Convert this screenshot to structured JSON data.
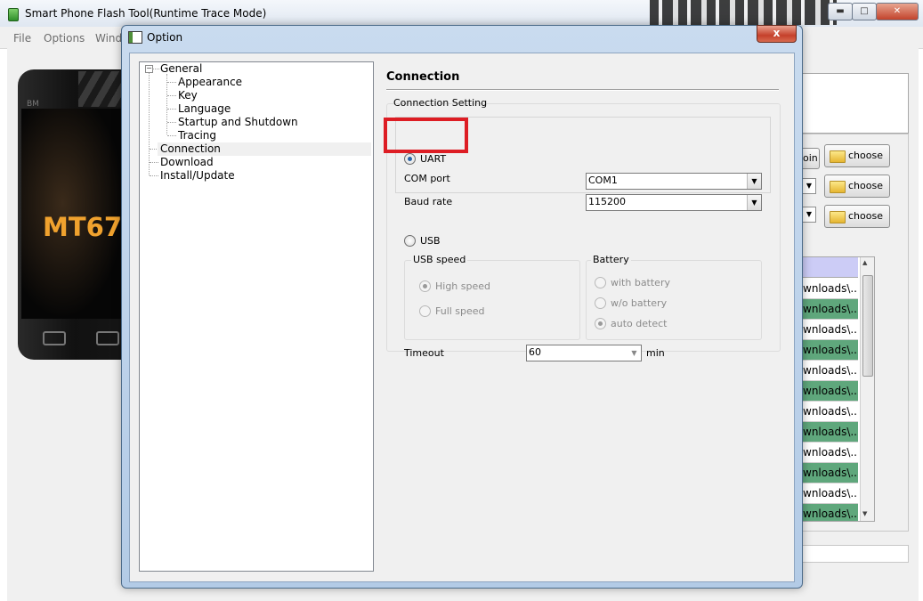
{
  "main_window": {
    "title": "Smart Phone Flash Tool(Runtime Trace Mode)",
    "menu": [
      "File",
      "Options",
      "Wind"
    ],
    "phone_model_text": "MT67",
    "phone_brand_text": "BM",
    "pin_label": "oin",
    "choose_buttons": [
      "choose",
      "choose",
      "choose"
    ],
    "file_list_rows": [
      "wnloads\\...",
      "wnloads\\...",
      "wnloads\\...",
      "wnloads\\...",
      "wnloads\\...",
      "wnloads\\...",
      "wnloads\\...",
      "wnloads\\...",
      "wnloads\\...",
      "wnloads\\...",
      "wnloads\\...",
      "wnloads\\..."
    ]
  },
  "dialog": {
    "title": "Option",
    "close_label": "x",
    "tree": {
      "general": "General",
      "general_children": [
        "Appearance",
        "Key",
        "Language",
        "Startup and Shutdown",
        "Tracing"
      ],
      "others": [
        "Connection",
        "Download",
        "Install/Update"
      ],
      "selected": "Connection"
    },
    "pane": {
      "title": "Connection",
      "group_label": "Connection Setting",
      "uart": {
        "label": "UART",
        "selected": true,
        "com_port_label": "COM port",
        "com_port_value": "COM1",
        "baud_rate_label": "Baud rate",
        "baud_rate_value": "115200"
      },
      "usb": {
        "label": "USB",
        "selected": false,
        "speed_group": "USB speed",
        "speed_options": [
          "High speed",
          "Full speed"
        ],
        "speed_selected": "High speed",
        "battery_group": "Battery",
        "battery_options": [
          "with battery",
          "w/o battery",
          "auto detect"
        ],
        "battery_selected": "auto detect"
      },
      "timeout": {
        "label": "Timeout",
        "value": "60",
        "unit": "min"
      }
    }
  },
  "colors": {
    "highlight": "#dd1d24",
    "list_green": "#5fa77c",
    "list_header": "#ccccf6"
  }
}
